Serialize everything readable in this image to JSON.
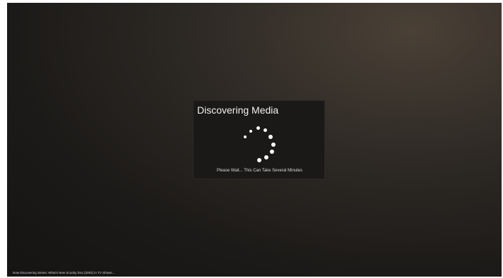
{
  "dialog": {
    "title": "Discovering Media",
    "message": "Please Wait... This Can Take Several Minutes",
    "spinner_icon": "loading-spinner-icon"
  },
  "status": {
    "text": "Now Discovering Series: What's New Scooby Doo (2002) in TV Shows..."
  },
  "colors": {
    "background": "#1c1a18",
    "dialog_bg": "#1a1918",
    "text": "#f2f2f2"
  }
}
